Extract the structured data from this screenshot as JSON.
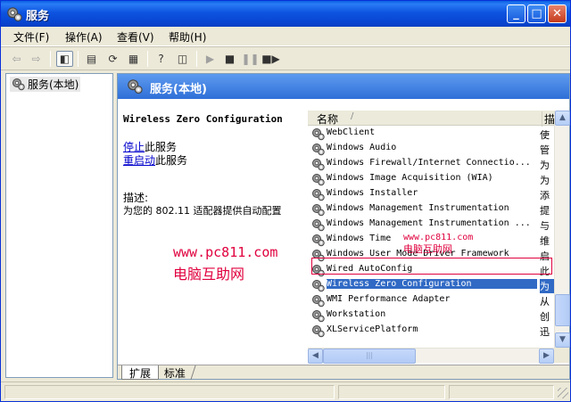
{
  "window": {
    "title": "服务"
  },
  "menu": [
    "文件(F)",
    "操作(A)",
    "查看(V)",
    "帮助(H)"
  ],
  "tree": {
    "item": "服务(本地)"
  },
  "right_header": {
    "title": "服务(本地)"
  },
  "detail": {
    "service_name": "Wireless Zero Configuration",
    "stop_link": "停止",
    "stop_suffix": "此服务",
    "restart_link": "重启动",
    "restart_suffix": "此服务",
    "desc_label": "描述:",
    "desc_text": "为您的 802.11 适配器提供自动配置"
  },
  "list": {
    "col_name": "名称",
    "col_sort": "/",
    "col_desc": "描",
    "rows": [
      {
        "name": "WebClient",
        "desc": "使"
      },
      {
        "name": "Windows Audio",
        "desc": "管"
      },
      {
        "name": "Windows Firewall/Internet Connectio...",
        "desc": "为"
      },
      {
        "name": "Windows Image Acquisition (WIA)",
        "desc": "为"
      },
      {
        "name": "Windows Installer",
        "desc": "添"
      },
      {
        "name": "Windows Management Instrumentation",
        "desc": "提"
      },
      {
        "name": "Windows Management Instrumentation ...",
        "desc": "与"
      },
      {
        "name": "Windows Time",
        "desc": "维"
      },
      {
        "name": "Windows User Mode Driver Framework",
        "desc": "启"
      },
      {
        "name": "Wired AutoConfig",
        "desc": "此"
      },
      {
        "name": "Wireless Zero Configuration",
        "desc": "为",
        "selected": true
      },
      {
        "name": "WMI Performance Adapter",
        "desc": "从"
      },
      {
        "name": "Workstation",
        "desc": "创"
      },
      {
        "name": "XLServicePlatform",
        "desc": "迅"
      }
    ]
  },
  "tabs": {
    "extended": "扩展",
    "standard": "标准"
  },
  "watermarks": {
    "big_url": "www.pc811.com",
    "big_name": "电脑互助网",
    "small_url": "www.pc811.com",
    "small_name": "电脑互助网"
  },
  "colors": {
    "titlebar": "#0a5fe0",
    "selection": "#316ac5",
    "watermark": "#e0003e"
  }
}
